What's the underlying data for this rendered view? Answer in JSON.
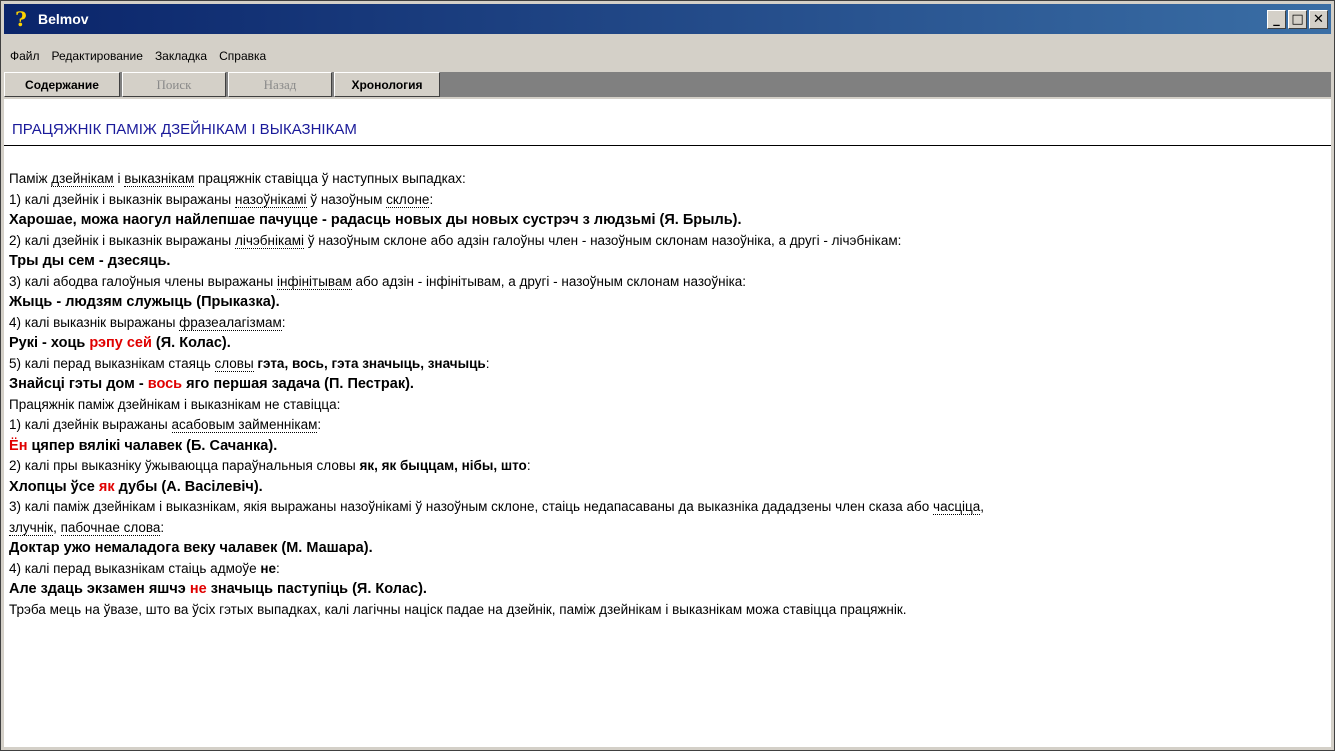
{
  "window": {
    "title": "Belmov"
  },
  "menu": [
    "Файл",
    "Редактирование",
    "Закладка",
    "Справка"
  ],
  "toolbar": [
    "Содержание",
    "Поиск",
    "Назад",
    "Хронология"
  ],
  "heading": "ПРАЦЯЖНІК ПАМІЖ ДЗЕЙНІКАМ І ВЫКАЗНІКАМ",
  "lines": [
    [
      [
        "t",
        "Паміж "
      ],
      [
        "u",
        "дзейнікам"
      ],
      [
        "t",
        " і "
      ],
      [
        "u",
        "выказнікам"
      ],
      [
        "t",
        " працяжнік ставіцца ў наступных выпадках:"
      ]
    ],
    [
      [
        "t",
        "1) калі дзейнік і выказнік выражаны "
      ],
      [
        "u",
        "назоўнікамі"
      ],
      [
        "t",
        " ў назоўным "
      ],
      [
        "u",
        "склоне"
      ],
      [
        "t",
        ":"
      ]
    ],
    [
      [
        "ex",
        "Харошае, можа наогул найлепшае пачуцце - радасць новых ды новых сустрэч з людзьмі (Я. Брыль)."
      ]
    ],
    [
      [
        "t",
        "2) калі дзейнік і выказнік выражаны "
      ],
      [
        "u",
        "лічэбнікамі"
      ],
      [
        "t",
        " ў назоўным склоне або адзін галоўны член - назоўным склонам назоўніка, а другі - лічэбнікам:"
      ]
    ],
    [
      [
        "ex",
        "Тры ды сем - дзесяць."
      ]
    ],
    [
      [
        "t",
        "3) калі абодва галоўныя члены выражаны "
      ],
      [
        "u",
        "інфінітывам"
      ],
      [
        "t",
        " або адзін - інфінітывам, а другі - назоўным склонам назоўніка:"
      ]
    ],
    [
      [
        "ex",
        "Жыць - людзям служыць (Прыказка)."
      ]
    ],
    [
      [
        "t",
        "4) калі выказнік выражаны "
      ],
      [
        "u",
        "фразеалагізмам"
      ],
      [
        "t",
        ":"
      ]
    ],
    [
      [
        "ex",
        "Рукі - хоць "
      ],
      [
        "exred",
        "рэпу сей"
      ],
      [
        "ex",
        " (Я. Колас)."
      ]
    ],
    [
      [
        "t",
        "5) калі перад выказнікам стаяць "
      ],
      [
        "u",
        "словы"
      ],
      [
        "tb",
        " гэта, вось, гэта значыць, значыць"
      ],
      [
        "t",
        ":"
      ]
    ],
    [
      [
        "ex",
        "Знайсці гэты дом - "
      ],
      [
        "exred",
        "вось"
      ],
      [
        "ex",
        " яго першая задача (П. Пестрак)."
      ]
    ],
    [
      [
        "t",
        "Працяжнік паміж дзейнікам і выказнікам не ставіцца:"
      ]
    ],
    [
      [
        "t",
        "1) калі дзейнік выражаны "
      ],
      [
        "u",
        "асабовым займеннікам"
      ],
      [
        "t",
        ":"
      ]
    ],
    [
      [
        "exred",
        "Ён"
      ],
      [
        "ex",
        " цяпер вялікі чалавек (Б. Сачанка)."
      ]
    ],
    [
      [
        "t",
        "2) калі пры выказніку ўжываюцца параўнальныя словы "
      ],
      [
        "tb",
        "як, як быццам, нібы, што"
      ],
      [
        "t",
        ":"
      ]
    ],
    [
      [
        "ex",
        "Хлопцы ўсе "
      ],
      [
        "exred",
        "як"
      ],
      [
        "ex",
        " дубы (А. Васілевіч)."
      ]
    ],
    [
      [
        "t",
        "3) калі паміж дзейнікам і выказнікам, якія выражаны назоўнікамі ў назоўным склоне, стаіць недапасаваны да выказніка дададзены член сказа або "
      ],
      [
        "u",
        "часціца"
      ],
      [
        "t",
        ","
      ]
    ],
    [
      [
        "u",
        "злучнік"
      ],
      [
        "t",
        ", "
      ],
      [
        "u",
        "пабочнае слова"
      ],
      [
        "t",
        ":"
      ]
    ],
    [
      [
        "ex",
        "Доктар ужо немаладога веку чалавек (М. Машара)."
      ]
    ],
    [
      [
        "t",
        "4) калі перад выказнікам стаіць адмоўе "
      ],
      [
        "tb",
        "не"
      ],
      [
        "t",
        ":"
      ]
    ],
    [
      [
        "ex",
        "Але здаць экзамен яшчэ "
      ],
      [
        "exred",
        "не"
      ],
      [
        "ex",
        " значыць паступіць (Я. Колас)."
      ]
    ],
    [
      [
        "t",
        "Трэба мець на ўвазе, што ва ўсіх гэтых выпадках, калі лагічны націск падае на дзейнік, паміж дзейнікам і выказнікам можа ставіцца працяжнік."
      ]
    ]
  ]
}
